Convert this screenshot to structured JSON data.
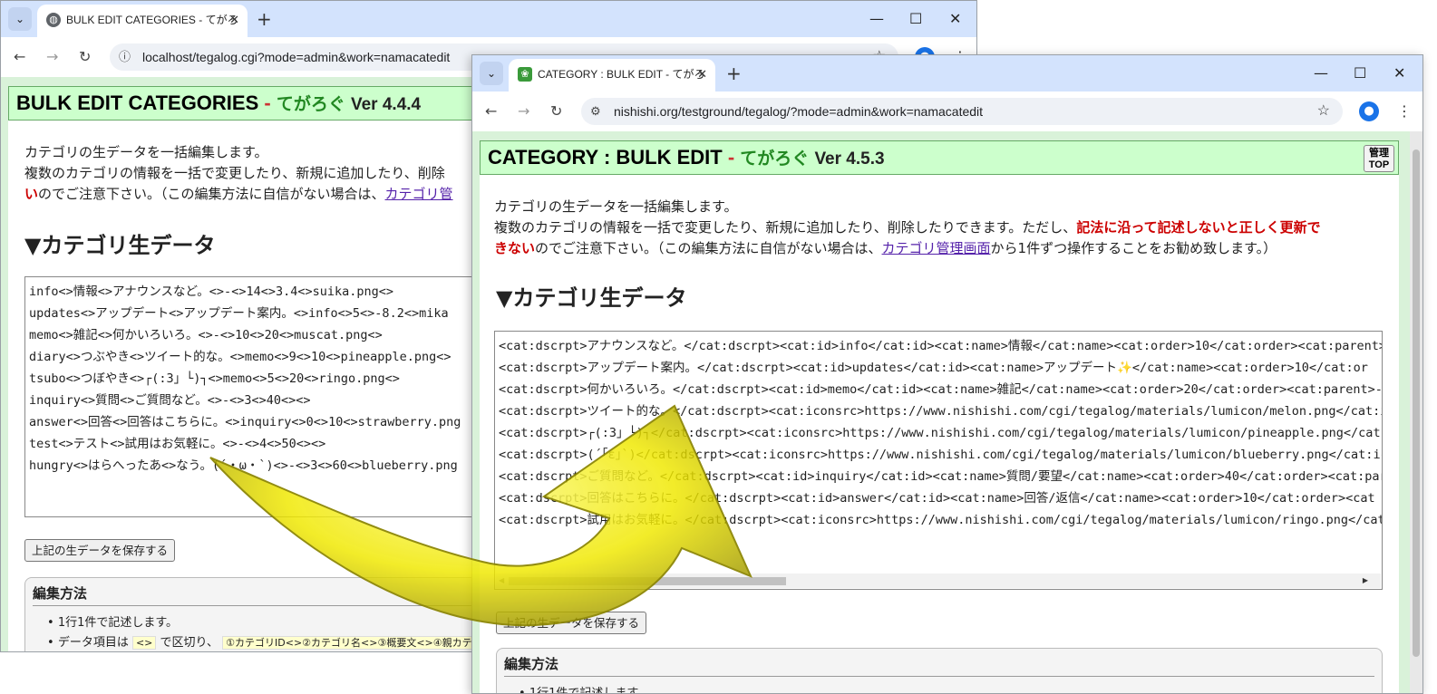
{
  "window_a": {
    "tab_title": "BULK EDIT CATEGORIES - てがろ",
    "url": "localhost/tegalog.cgi?mode=admin&work=namacatedit",
    "header": {
      "title": "BULK EDIT CATEGORIES",
      "app": "てがろぐ",
      "version": "Ver 4.4.4"
    },
    "intro_line1": "カテゴリの生データを一括編集します。",
    "intro_line2": "複数のカテゴリの情報を一括で変更したり、新規に追加したり、削除",
    "intro_line3_red": "い",
    "intro_line3_text": "のでご注意下さい。（この編集方法に自信がない場合は、",
    "intro_line3_link": "カテゴリ管",
    "section_title": "▼カテゴリ生データ",
    "raw_lines": [
      "info<>情報<>アナウンスなど。<>-<>14<>3.4<>suika.png<>",
      "updates<>アップデート<>アップデート案内。<>info<>5<>-8.2<>mika",
      "memo<>雑記<>何かいろいろ。<>-<>10<>20<>muscat.png<>",
      "diary<>つぶやき<>ツイート的な。<>memo<>9<>10<>pineapple.png<>",
      "tsubo<>つぼやき<>┌(:3」└)┐<>memo<>5<>20<>ringo.png<>",
      "inquiry<>質問<>ご質問など。<>-<>3<>40<><>",
      "answer<>回答<>回答はこちらに。<>inquiry<>0<>10<>strawberry.png",
      "test<>テスト<>試用はお気軽に。<>-<>4<>50<><>",
      "hungry<>はらへったあ<>なう。(´・ω・`)<>-<>3<>60<>blueberry.png"
    ],
    "save_button": "上記の生データを保存する",
    "howto_title": "編集方法",
    "howto_item1": "1行1件で記述します。",
    "howto_item2_a": "データ項目は",
    "howto_item2_code": "<>",
    "howto_item2_b": "で区切り、",
    "howto_item2_c": "①カテゴリID<>②カテゴリ名<>③概要文<>④親カテゴ"
  },
  "window_b": {
    "tab_title": "CATEGORY : BULK EDIT - てがろ",
    "url": "nishishi.org/testground/tegalog/?mode=admin&work=namacatedit",
    "header": {
      "title": "CATEGORY : BULK EDIT",
      "app": "てがろぐ",
      "version": "Ver 4.5.3"
    },
    "admin_top_button": [
      "管理",
      "TOP"
    ],
    "intro_line1": "カテゴリの生データを一括編集します。",
    "intro_line2": "複数のカテゴリの情報を一括で変更したり、新規に追加したり、削除したりできます。ただし、",
    "intro_line2_red": "記法に沿って記述しないと正しく更新で",
    "intro_line3_red": "きない",
    "intro_line3_text": "のでご注意下さい。（この編集方法に自信がない場合は、",
    "intro_line3_link": "カテゴリ管理画面",
    "intro_line3_tail": "から1件ずつ操作することをお勧め致します。）",
    "section_title": "▼カテゴリ生データ",
    "raw_lines": [
      "<cat:dscrpt>アナウンスなど。</cat:dscrpt><cat:id>info</cat:id><cat:name>情報</cat:name><cat:order>10</cat:order><cat:parent>",
      "<cat:dscrpt>アップデート案内。</cat:dscrpt><cat:id>updates</cat:id><cat:name>アップデート✨</cat:name><cat:order>10</cat:or",
      "<cat:dscrpt>何かいろいろ。</cat:dscrpt><cat:id>memo</cat:id><cat:name>雑記</cat:name><cat:order>20</cat:order><cat:parent>-",
      "<cat:dscrpt>ツイート的な。</cat:dscrpt><cat:iconsrc>https://www.nishishi.com/cgi/tegalog/materials/lumicon/melon.png</cat:ic",
      "<cat:dscrpt>┌(:3」└)┐</cat:dscrpt><cat:iconsrc>https://www.nishishi.com/cgi/tegalog/materials/lumicon/pineapple.png</cat",
      "<cat:dscrpt>(´｢ε｣`)</cat:dscrpt><cat:iconsrc>https://www.nishishi.com/cgi/tegalog/materials/lumicon/blueberry.png</cat:ic",
      "<cat:dscrpt>ご質問など。</cat:dscrpt><cat:id>inquiry</cat:id><cat:name>質問/要望</cat:name><cat:order>40</cat:order><cat:par",
      "<cat:dscrpt>回答はこちらに。</cat:dscrpt><cat:id>answer</cat:id><cat:name>回答/返信</cat:name><cat:order>10</cat:order><cat",
      "<cat:dscrpt>試用はお気軽に。</cat:dscrpt><cat:iconsrc>https://www.nishishi.com/cgi/tegalog/materials/lumicon/ringo.png</cat"
    ],
    "save_button": "上記の生データを保存する",
    "howto_title": "編集方法",
    "howto_item1": "1行1件で記述します。"
  },
  "colors": {
    "header_bg": "#ccffcc",
    "red_text": "#cc0000",
    "link": "#5522aa",
    "arrow": "#f2ee00",
    "tabbar": "#d3e3fd"
  },
  "icons": [
    "chevron-down-icon",
    "globe-icon",
    "leaf-favicon-icon",
    "close-icon",
    "plus-icon",
    "minimize-icon",
    "maximize-icon",
    "back-arrow-icon",
    "forward-arrow-icon",
    "reload-icon",
    "info-icon",
    "tune-icon",
    "star-icon",
    "profile-icon",
    "kebab-menu-icon",
    "curved-arrow-icon"
  ]
}
